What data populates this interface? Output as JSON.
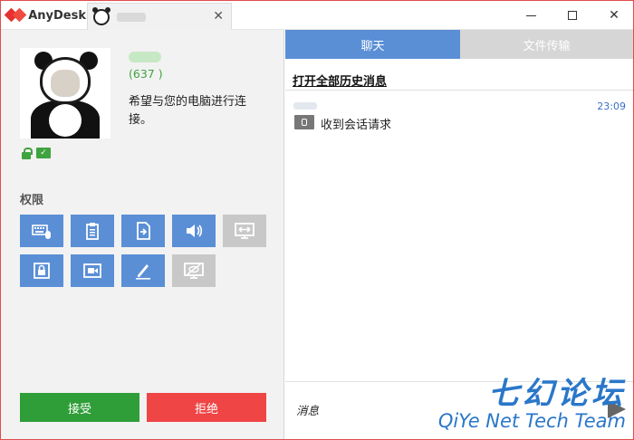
{
  "app": {
    "name": "AnyDesk"
  },
  "session_tab": {
    "close_label": "✕"
  },
  "window_controls": {
    "close_label": "✕"
  },
  "peer": {
    "id_text": "(637          )",
    "request_message": "希望与您的电脑进行连接。"
  },
  "permissions": {
    "title": "权限",
    "buttons": [
      {
        "name": "keyboard-mouse",
        "enabled": true
      },
      {
        "name": "clipboard",
        "enabled": true
      },
      {
        "name": "file-transfer",
        "enabled": true
      },
      {
        "name": "sound",
        "enabled": true
      },
      {
        "name": "control",
        "enabled": false
      },
      {
        "name": "lock",
        "enabled": true
      },
      {
        "name": "record",
        "enabled": true
      },
      {
        "name": "draw",
        "enabled": true
      },
      {
        "name": "privacy",
        "enabled": false
      }
    ]
  },
  "actions": {
    "accept": "接受",
    "reject": "拒绝"
  },
  "chat": {
    "tabs": {
      "chat": "聊天",
      "file_transfer": "文件传输"
    },
    "history_link": "打开全部历史消息",
    "messages": [
      {
        "time": "23:09",
        "text": "收到会话请求"
      }
    ],
    "input_placeholder": "消息"
  },
  "watermark": {
    "cn": "七幻论坛",
    "en": "QiYe Net Tech Team"
  },
  "colors": {
    "accent": "#5a8fd6",
    "accept": "#2f9e38",
    "reject": "#ef4545",
    "brand": "#e5312f"
  }
}
